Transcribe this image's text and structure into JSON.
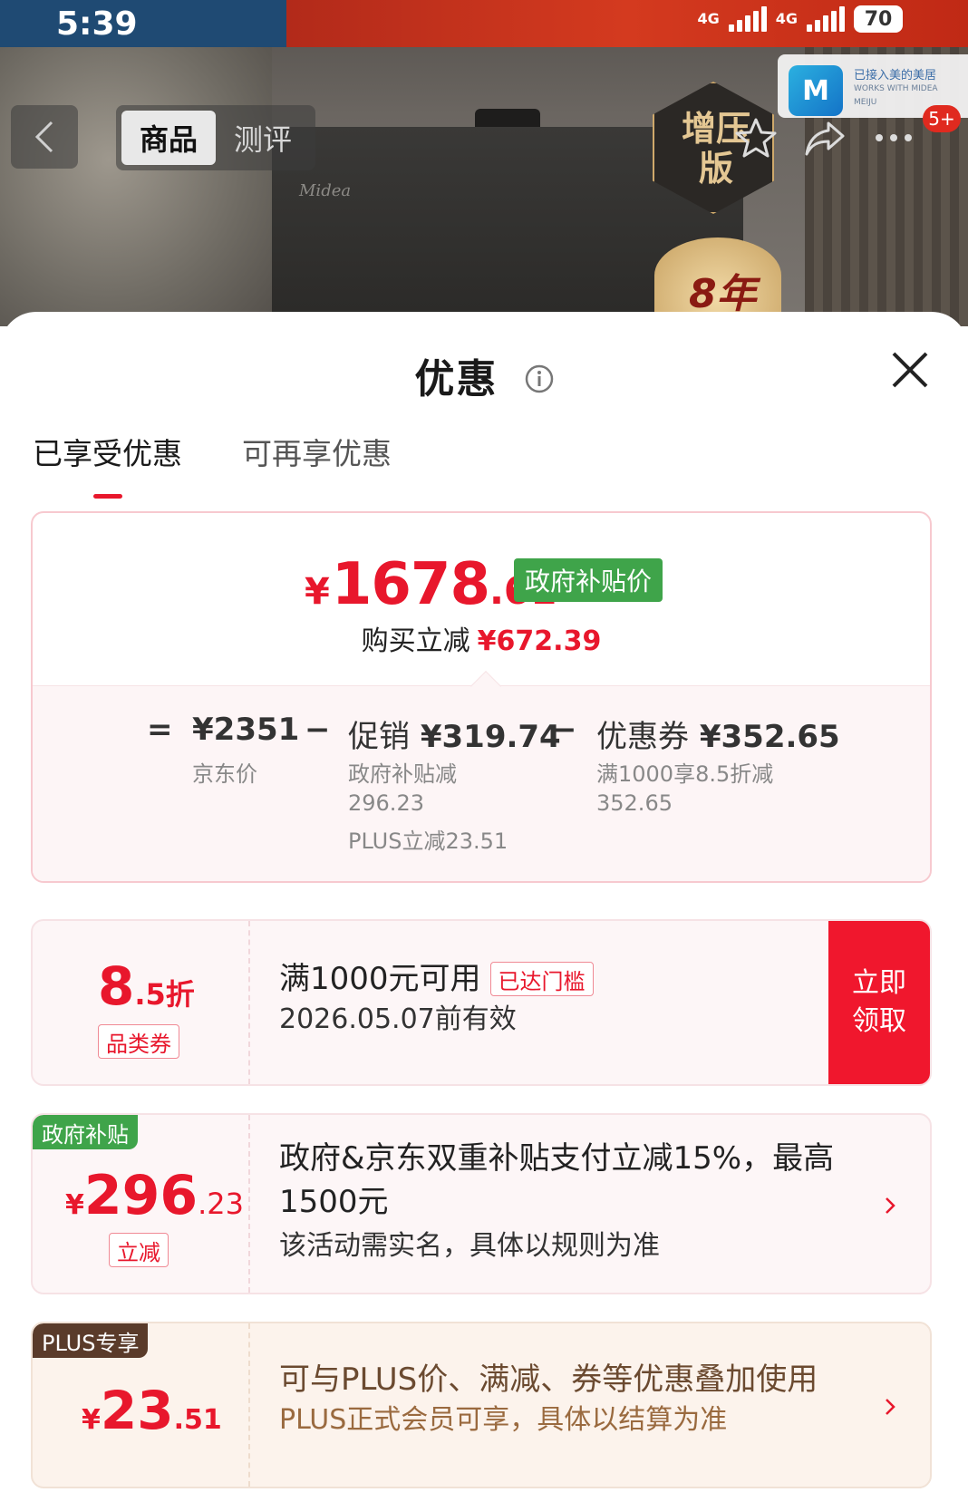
{
  "status_bar": {
    "time": "5:39",
    "net1": "4G",
    "net2": "4G",
    "battery": "70"
  },
  "product_nav": {
    "tabs": [
      {
        "label": "商品",
        "active": true
      },
      {
        "label": "测评",
        "active": false
      }
    ],
    "notification_count": "5+"
  },
  "backdrop": {
    "brand_mark": "Midea",
    "badge_text": "增压版",
    "years_badge": "8年",
    "meiju_text": "已接入美的美居",
    "meiju_sub": "WORKS WITH MIDEA MEIJU",
    "meiju_logo": "M"
  },
  "sheet": {
    "title": "优惠",
    "tabs": [
      {
        "label": "已享受优惠",
        "active": true
      },
      {
        "label": "可再享优惠",
        "active": false
      }
    ]
  },
  "summary": {
    "currency": "¥",
    "final_int": "1678",
    "final_dec": ".61",
    "gov_tag": "政府补贴价",
    "reduce_label": "购买立减",
    "reduce_amount": "¥672.39",
    "eq": "=",
    "minus": "−",
    "jd_price": "¥2351",
    "jd_label": "京东价",
    "promo_label": "促销",
    "promo_amount": "¥319.74",
    "promo_sub1": "政府补贴减",
    "promo_sub2": "296.23",
    "promo_sub3": "PLUS立减23.51",
    "coupon_label": "优惠券",
    "coupon_amount": "¥352.65",
    "coupon_sub1": "满1000享8.5折减",
    "coupon_sub2": "352.65"
  },
  "coupon_card": {
    "disc_big": "8",
    "disc_small": ".5折",
    "type_tag": "品类券",
    "title": "满1000元可用",
    "threshold_tag": "已达门槛",
    "valid": "2026.05.07前有效",
    "claim_label": "立即领取"
  },
  "gov_card": {
    "corner_tag": "政府补贴",
    "currency": "¥",
    "amount_int": "296",
    "amount_dec": ".23",
    "type_tag": "立减",
    "title": "政府&京东双重补贴支付立减15%，最高1500元",
    "desc": "该活动需实名，具体以规则为准"
  },
  "plus_card": {
    "corner_tag": "PLUS专享",
    "currency": "¥",
    "amount_int": "23",
    "amount_dec": ".51",
    "title": "可与PLUS价、满减、券等优惠叠加使用",
    "desc": "PLUS正式会员可享，具体以结算为准"
  },
  "colors": {
    "accent": "#e8172c",
    "gov_green": "#3fa44a",
    "plus_brown": "#5a3b2a",
    "plus_text": "#9a6a3f"
  }
}
